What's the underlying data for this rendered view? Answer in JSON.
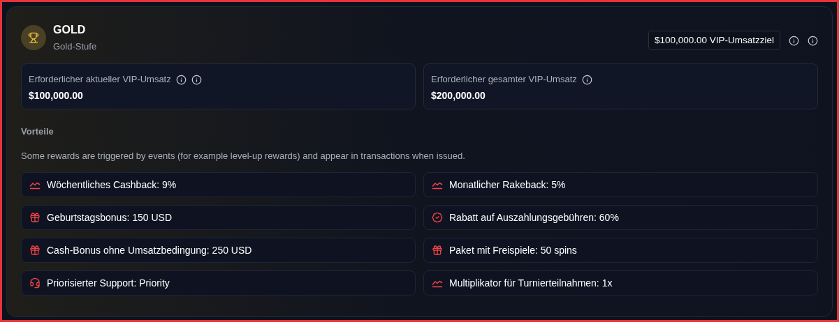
{
  "tier": {
    "title": "GOLD",
    "subtitle": "Gold-Stufe",
    "target": "$100,000.00 VIP-Umsatzziel"
  },
  "stats": [
    {
      "kind": "double_info",
      "label": "Erforderlicher aktueller VIP-Umsatz",
      "value": "$100,000.00"
    },
    {
      "kind": "single_info",
      "label": "Erforderlicher gesamter VIP-Umsatz",
      "value": "$200,000.00"
    }
  ],
  "benefits": {
    "title": "Vorteile",
    "note": "Some rewards are triggered by events (for example level-up rewards) and appear in transactions when issued.",
    "items": [
      {
        "kind": "trend",
        "text": "Wöchentliches Cashback: 9%"
      },
      {
        "kind": "trend",
        "text": "Monatlicher Rakeback: 5%"
      },
      {
        "kind": "gift",
        "text": "Geburtstagsbonus: 150 USD"
      },
      {
        "kind": "badge",
        "text": "Rabatt auf Auszahlungsgebühren: 60%"
      },
      {
        "kind": "gift",
        "text": "Cash-Bonus ohne Umsatzbedingung: 250 USD"
      },
      {
        "kind": "gift",
        "text": "Paket mit Freispiele: 50 spins"
      },
      {
        "kind": "support",
        "text": "Priorisierter Support: Priority"
      },
      {
        "kind": "trend",
        "text": "Multiplikator für Turnierteilnahmen: 1x"
      }
    ]
  }
}
